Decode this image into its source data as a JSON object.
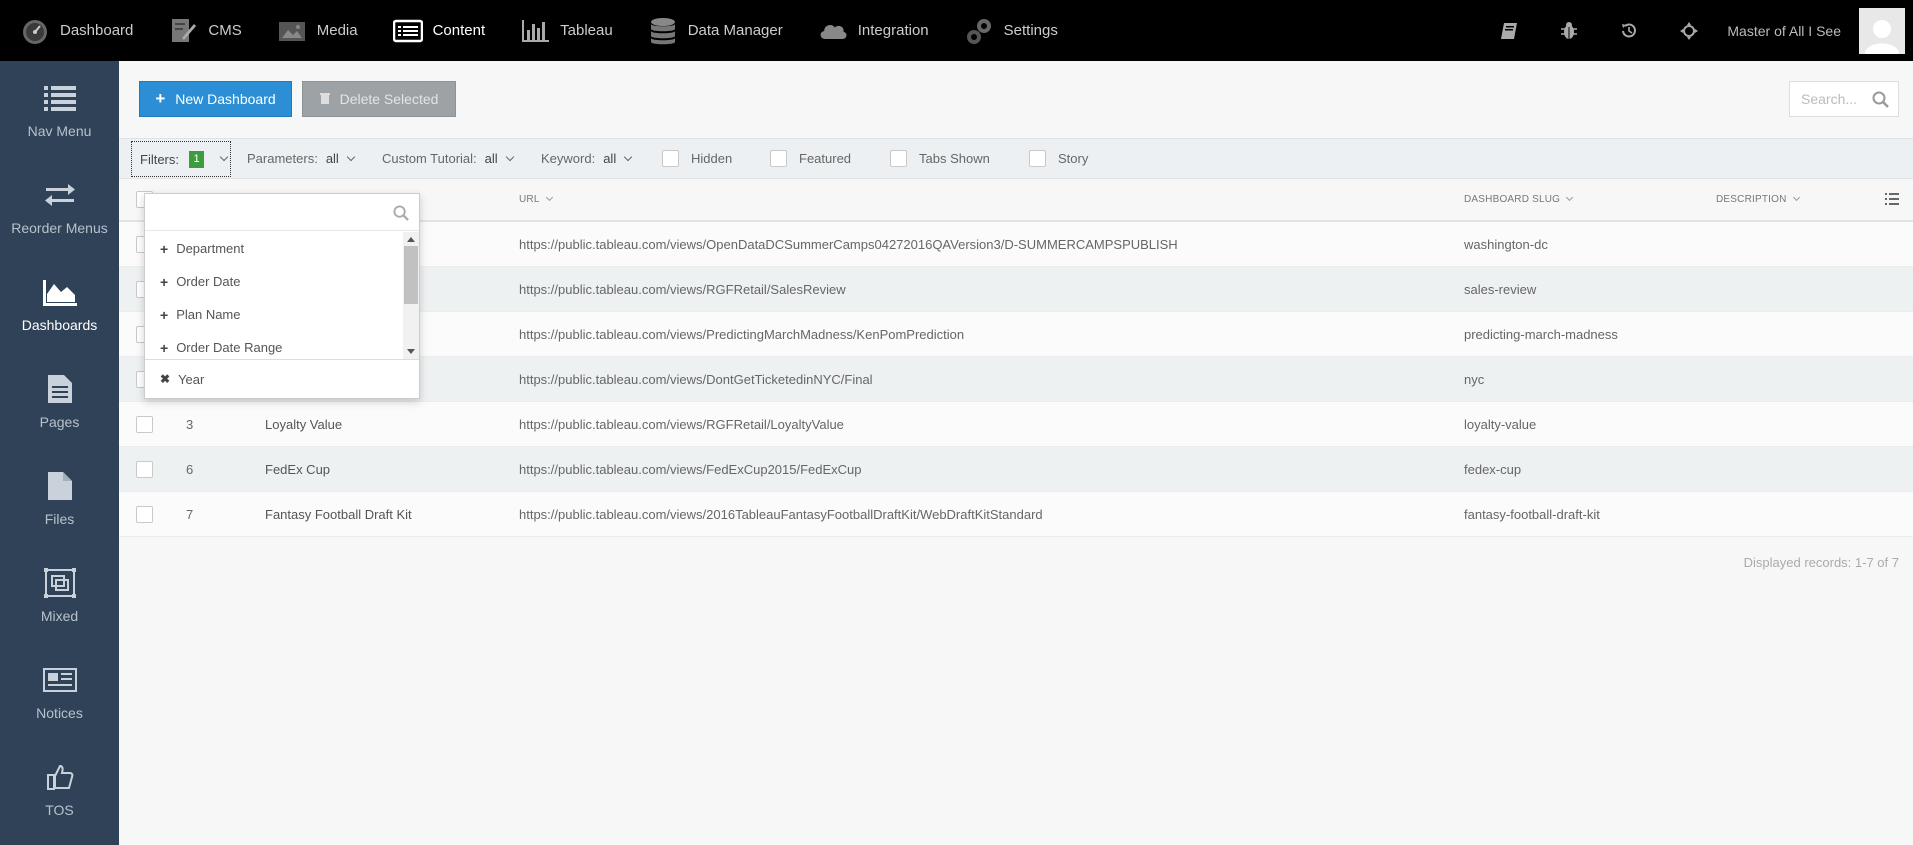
{
  "topnav": {
    "items": [
      {
        "label": "Dashboard",
        "icon": "speedometer-icon"
      },
      {
        "label": "CMS",
        "icon": "cms-edit-icon"
      },
      {
        "label": "Media",
        "icon": "media-icon"
      },
      {
        "label": "Content",
        "icon": "content-list-icon",
        "active": true
      },
      {
        "label": "Tableau",
        "icon": "bar-chart-icon"
      },
      {
        "label": "Data Manager",
        "icon": "database-icon"
      },
      {
        "label": "Integration",
        "icon": "cloud-icon"
      },
      {
        "label": "Settings",
        "icon": "gears-icon"
      }
    ],
    "right_icons": [
      "book-icon",
      "bug-icon",
      "history-icon",
      "crosshair-icon"
    ],
    "user_name": "Master of All I See"
  },
  "sidebar": {
    "items": [
      {
        "label": "Nav Menu",
        "icon": "list-icon"
      },
      {
        "label": "Reorder Menus",
        "icon": "arrows-exchange-icon"
      },
      {
        "label": "Dashboards",
        "icon": "area-chart-icon",
        "active": true
      },
      {
        "label": "Pages",
        "icon": "page-icon"
      },
      {
        "label": "Files",
        "icon": "file-icon"
      },
      {
        "label": "Mixed",
        "icon": "mixed-icon"
      },
      {
        "label": "Notices",
        "icon": "newspaper-icon"
      },
      {
        "label": "TOS",
        "icon": "thumbs-up-icon"
      }
    ]
  },
  "toolbar": {
    "new_label": "New Dashboard",
    "delete_label": "Delete Selected",
    "search_placeholder": "Search..."
  },
  "filters": {
    "label": "Filters:",
    "count": "1",
    "parameters_label": "Parameters:",
    "parameters_value": "all",
    "tutorial_label": "Custom Tutorial:",
    "tutorial_value": "all",
    "keyword_label": "Keyword:",
    "keyword_value": "all",
    "checks": [
      "Hidden",
      "Featured",
      "Tabs Shown",
      "Story"
    ]
  },
  "table": {
    "columns": {
      "url": "URL",
      "slug": "DASHBOARD SLUG",
      "description": "DESCRIPTION"
    },
    "rows": [
      {
        "id": "",
        "name": "",
        "url": "https://public.tableau.com/views/OpenDataDCSummerCamps04272016QAVersion3/D-SUMMERCAMPSPUBLISH",
        "slug": "washington-dc"
      },
      {
        "id": "",
        "name": "",
        "url": "https://public.tableau.com/views/RGFRetail/SalesReview",
        "slug": "sales-review"
      },
      {
        "id": "",
        "name": "",
        "url": "https://public.tableau.com/views/PredictingMarchMadness/KenPomPrediction",
        "slug": "predicting-march-madness"
      },
      {
        "id": "",
        "name": "",
        "url": "https://public.tableau.com/views/DontGetTicketedinNYC/Final",
        "slug": "nyc"
      },
      {
        "id": "3",
        "name": "Loyalty Value",
        "url": "https://public.tableau.com/views/RGFRetail/LoyaltyValue",
        "slug": "loyalty-value"
      },
      {
        "id": "6",
        "name": "FedEx Cup",
        "url": "https://public.tableau.com/views/FedExCup2015/FedExCup",
        "slug": "fedex-cup"
      },
      {
        "id": "7",
        "name": "Fantasy Football Draft Kit",
        "url": "https://public.tableau.com/views/2016TableauFantasyFootballDraftKit/WebDraftKitStandard",
        "slug": "fantasy-football-draft-kit"
      }
    ],
    "records_text": "Displayed records: 1-7 of 7"
  },
  "filter_dropdown": {
    "options": [
      "Department",
      "Order Date",
      "Plan Name",
      "Order Date Range"
    ],
    "selected": "Year"
  }
}
